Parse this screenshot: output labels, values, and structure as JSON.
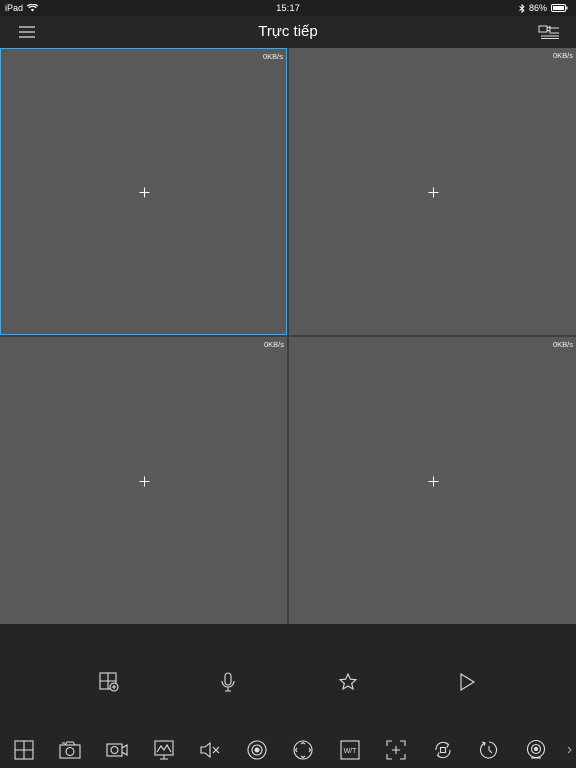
{
  "status_bar": {
    "device": "iPad",
    "time": "15:17",
    "battery": "86%",
    "icons": [
      "wifi-icon",
      "bluetooth-icon",
      "battery-icon"
    ]
  },
  "header": {
    "title": "Trực tiếp",
    "left_icon": "menu-icon",
    "right_icon": "device-list-icon"
  },
  "panes": [
    {
      "rate": "0KB/s",
      "selected": true
    },
    {
      "rate": "0KB/s",
      "selected": false
    },
    {
      "rate": "0KB/s",
      "selected": false
    },
    {
      "rate": "0KB/s",
      "selected": false
    }
  ],
  "control_row": [
    "layout-add-icon",
    "microphone-icon",
    "star-icon",
    "play-icon"
  ],
  "toolbar": [
    "split-screen-icon",
    "snapshot-icon",
    "record-icon",
    "image-adjust-icon",
    "mute-icon",
    "ptz-icon",
    "direction-icon",
    "wide-tele-icon",
    "zoom-icon",
    "sync-icon",
    "playback-time-icon",
    "fisheye-icon",
    "more-arrow-icon"
  ],
  "colors": {
    "background": "#222222",
    "pane": "#595959",
    "selected_border": "#4fa3d8",
    "toolbar": "#252525"
  }
}
